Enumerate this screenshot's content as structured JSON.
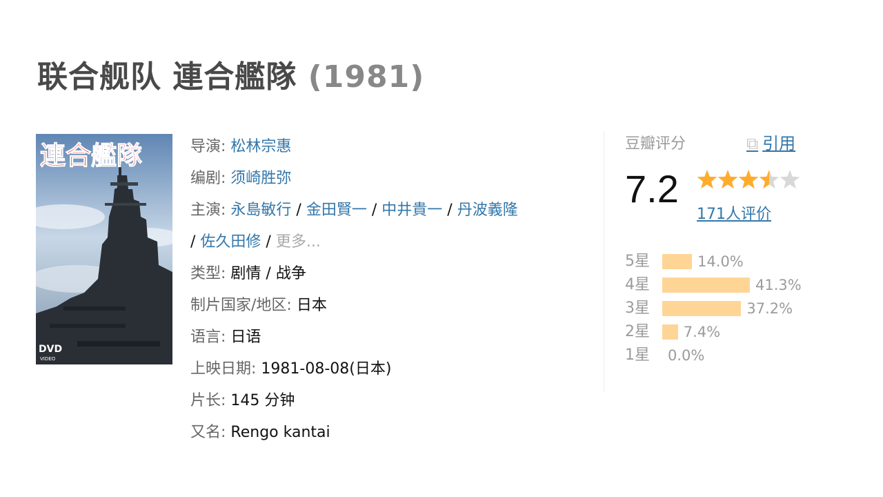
{
  "movie": {
    "title": "联合舰队 連合艦隊",
    "year": "(1981)",
    "poster": {
      "title_text": "連合艦隊",
      "badge": "DVD",
      "badge_sub": "VIDEO"
    }
  },
  "info": {
    "director_label": "导演:",
    "director": "松林宗惠",
    "writer_label": "编剧:",
    "writer": "须崎胜弥",
    "cast_label": "主演:",
    "cast": [
      "永島敏行",
      "金田賢一",
      "中井貴一",
      "丹波義隆",
      "佐久田修"
    ],
    "separator": " / ",
    "more": "更多...",
    "genre_label": "类型:",
    "genres": [
      "剧情",
      "战争"
    ],
    "country_label": "制片国家/地区:",
    "country": "日本",
    "language_label": "语言:",
    "language": "日语",
    "release_label": "上映日期:",
    "release": "1981-08-08(日本)",
    "runtime_label": "片长:",
    "runtime": "145 分钟",
    "aka_label": "又名:",
    "aka": "Rengo kantai"
  },
  "rating": {
    "label": "豆瓣评分",
    "cite_icon": "external-link-icon",
    "cite": "引用",
    "score": "7.2",
    "stars_value": 3.5,
    "votes": "171人评价",
    "star_color": "#ffac2d",
    "bar_color": "#ffd596",
    "distribution": [
      {
        "label": "5星",
        "percent": "14.0%",
        "value": 14.0
      },
      {
        "label": "4星",
        "percent": "41.3%",
        "value": 41.3
      },
      {
        "label": "3星",
        "percent": "37.2%",
        "value": 37.2
      },
      {
        "label": "2星",
        "percent": "7.4%",
        "value": 7.4
      },
      {
        "label": "1星",
        "percent": "0.0%",
        "value": 0.0
      }
    ]
  }
}
